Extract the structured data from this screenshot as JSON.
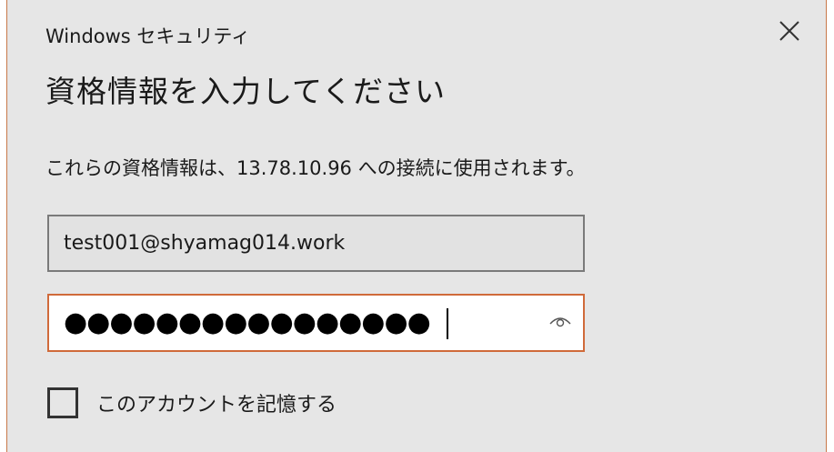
{
  "dialog": {
    "window_title": "Windows セキュリティ",
    "heading": "資格情報を入力してください",
    "description": "これらの資格情報は、13.78.10.96 への接続に使用されます。",
    "close_icon": "close-icon",
    "username": {
      "value": "test001@shyamag014.work"
    },
    "password": {
      "masked_value": "●●●●●●●●●●●●●●●●",
      "reveal_icon": "eye-icon"
    },
    "remember": {
      "label": "このアカウントを記憶する",
      "checked": false
    },
    "colors": {
      "background": "#e6e6e6",
      "focus_border": "#d06a3a",
      "window_border": "#c8794a"
    }
  }
}
